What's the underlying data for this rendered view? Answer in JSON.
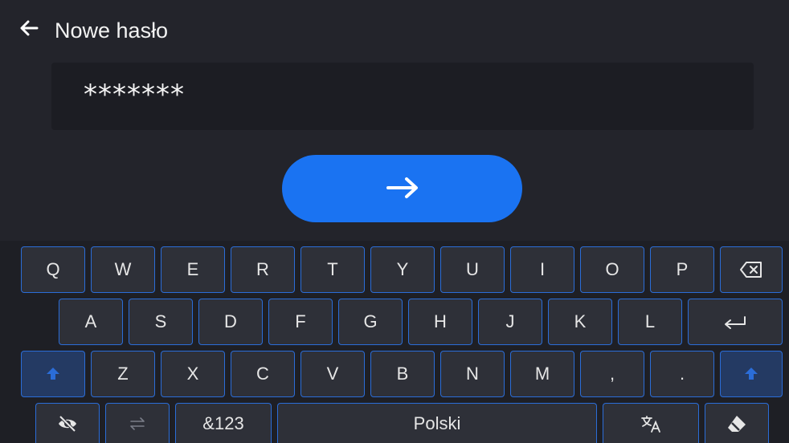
{
  "header": {
    "title": "Nowe hasło",
    "back_icon": "arrow-left-icon"
  },
  "password": {
    "value": "*******"
  },
  "confirm": {
    "icon": "arrow-right-icon",
    "color": "#1a73f2"
  },
  "keyboard": {
    "row1": [
      "Q",
      "W",
      "E",
      "R",
      "T",
      "Y",
      "U",
      "I",
      "O",
      "P"
    ],
    "row2": [
      "A",
      "S",
      "D",
      "F",
      "G",
      "H",
      "J",
      "K",
      "L"
    ],
    "row3": [
      "Z",
      "X",
      "C",
      "V",
      "B",
      "N",
      "M",
      ",",
      "."
    ],
    "symbols_label": "&123",
    "space_label": "Polski",
    "accent_color": "#2b6dd8",
    "icons": {
      "backspace": "backspace-icon",
      "enter": "enter-icon",
      "shift": "shift-icon",
      "hide": "eye-off-icon",
      "switch": "switch-arrows-icon",
      "translate": "translate-icon",
      "clear": "eraser-icon"
    }
  }
}
